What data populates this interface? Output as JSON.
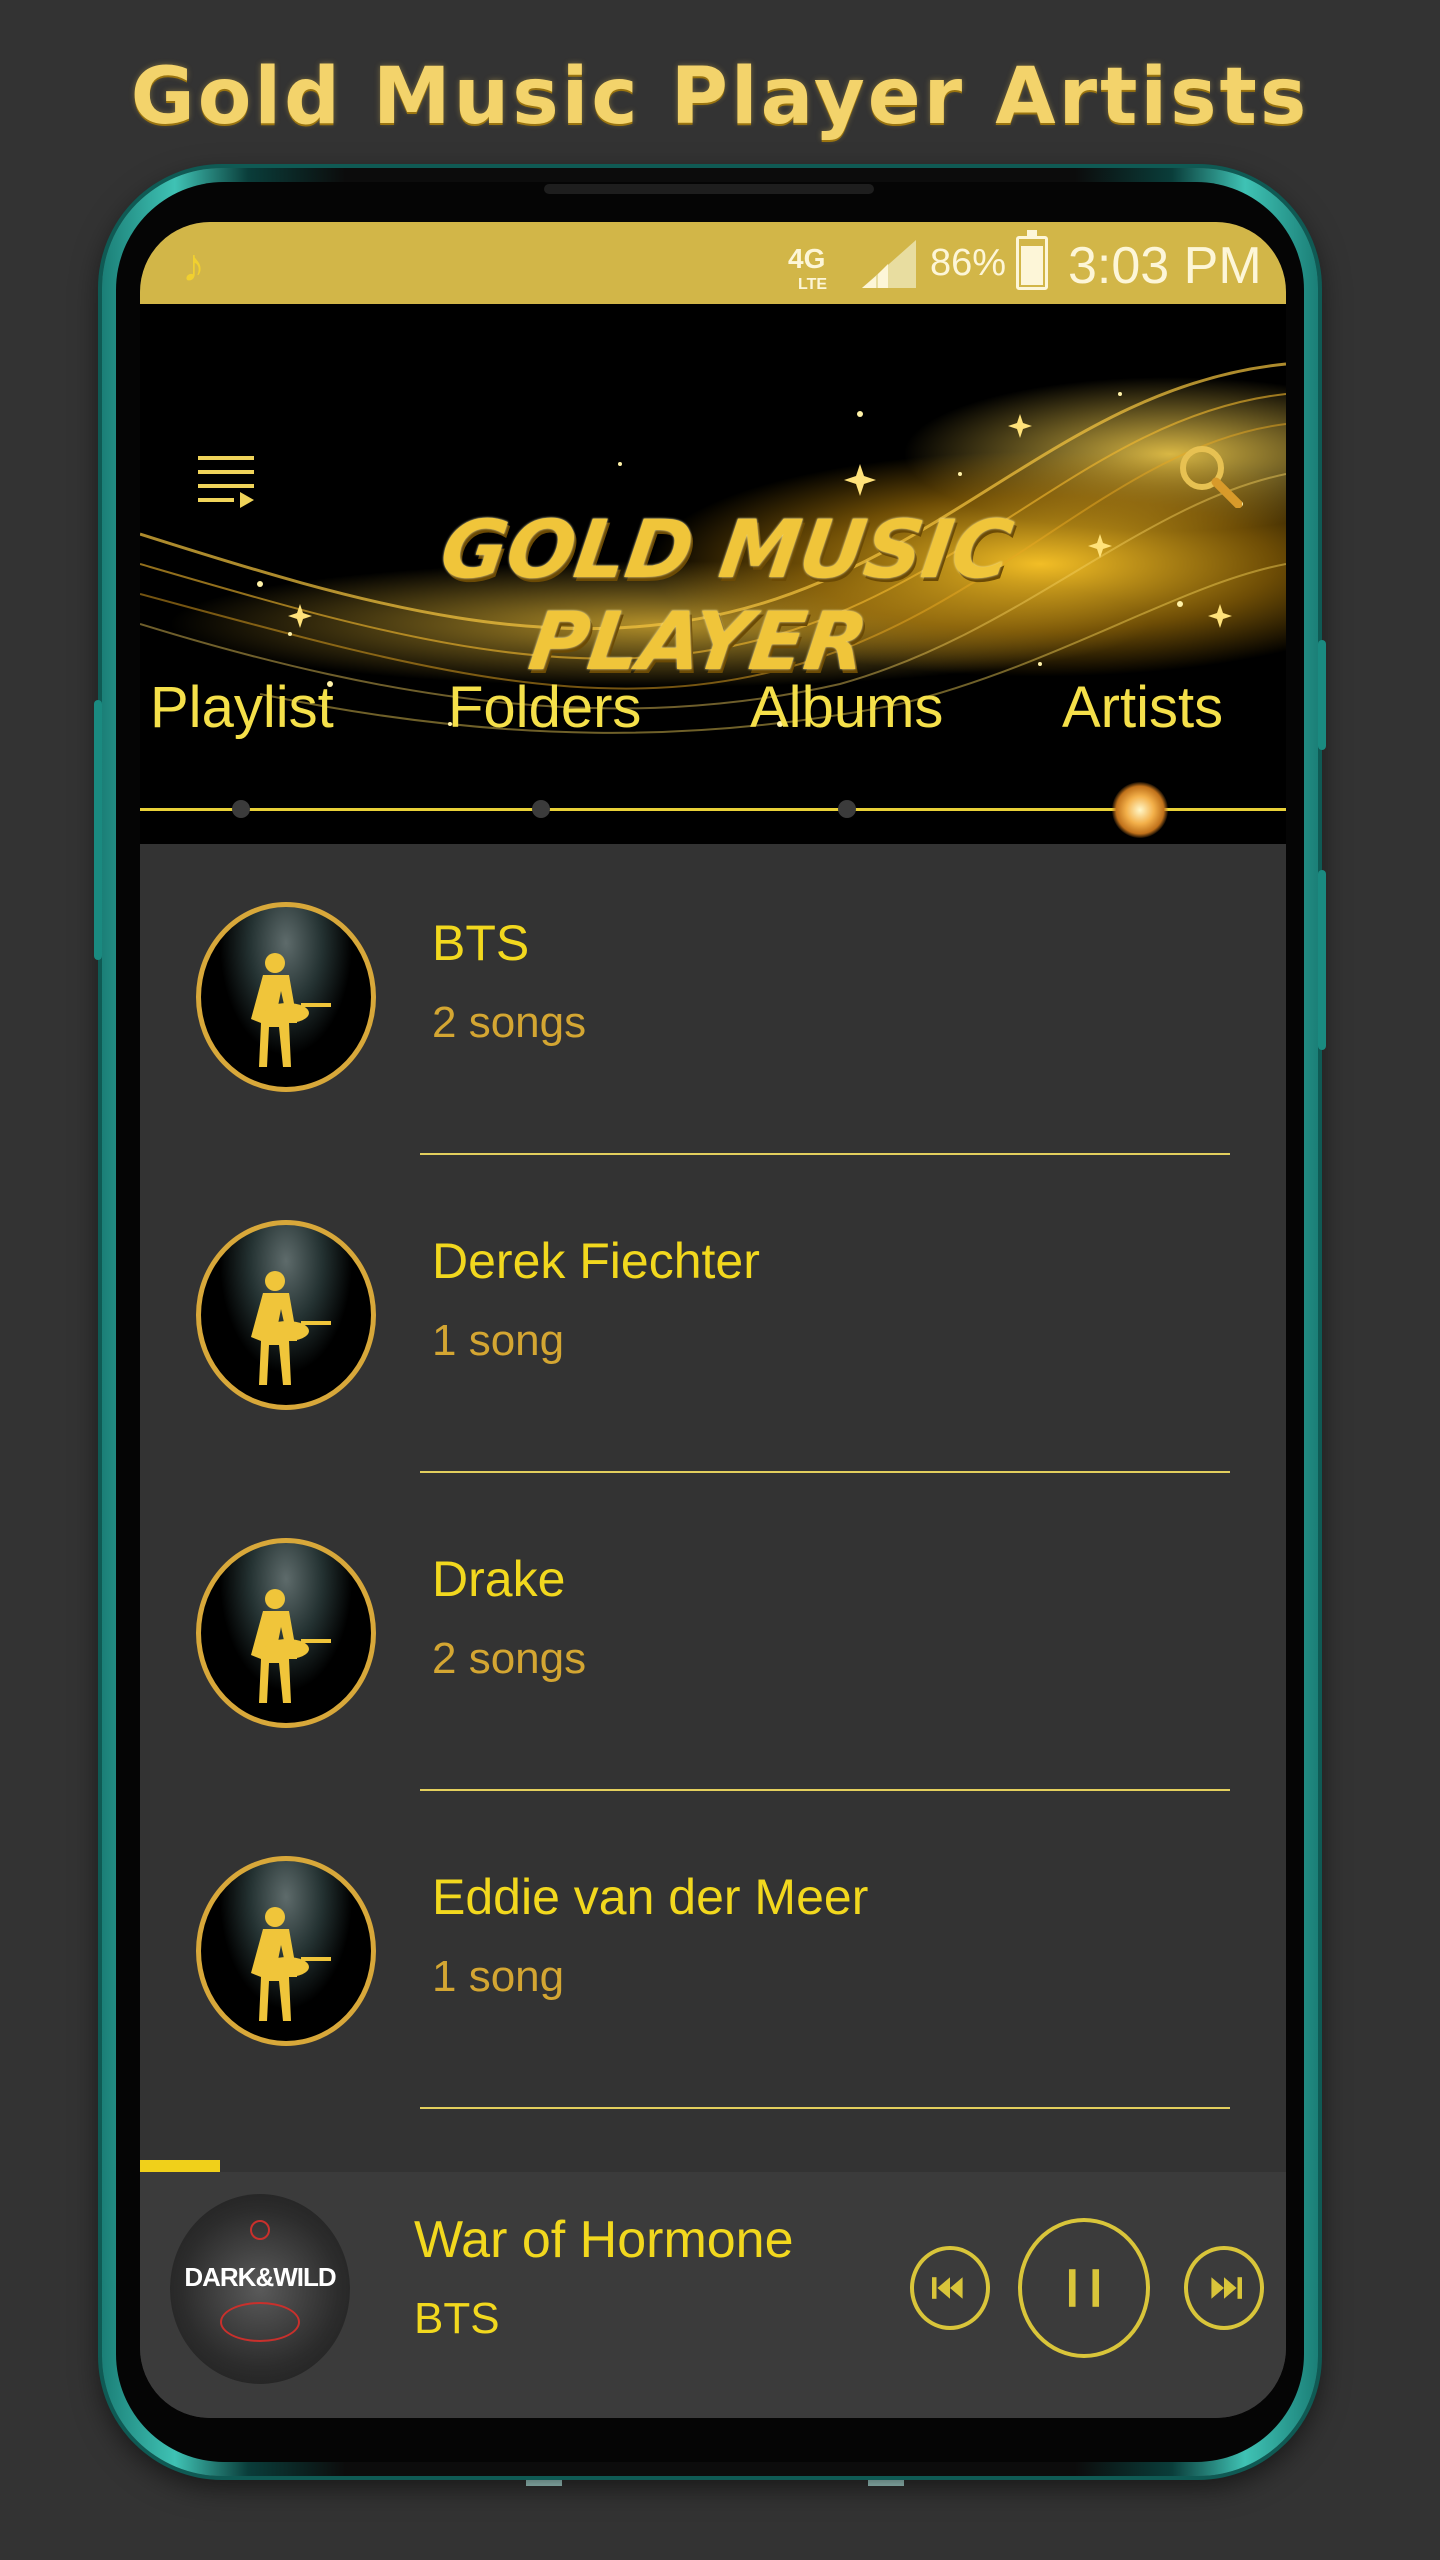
{
  "promo": {
    "title": "Gold Music Player Artists"
  },
  "status_bar": {
    "network_top": "4G",
    "network_bottom": "LTE",
    "battery": "86%",
    "time": "3:03 PM",
    "icon": "music-note-icon"
  },
  "header": {
    "logo_line1": "GOLD MUSIC",
    "logo_line2": "PLAYER",
    "menu_icon": "queue-menu-icon",
    "search_icon": "search-icon"
  },
  "tabs": [
    {
      "label": "Playlist"
    },
    {
      "label": "Folders"
    },
    {
      "label": "Albums"
    },
    {
      "label": "Artists",
      "active": true
    }
  ],
  "artists": [
    {
      "name": "BTS",
      "count": "2 songs"
    },
    {
      "name": "Derek Fiechter",
      "count": "1 song"
    },
    {
      "name": "Drake",
      "count": "2 songs"
    },
    {
      "name": "Eddie van der Meer",
      "count": "1 song"
    }
  ],
  "now_playing": {
    "title": "War of Hormone",
    "artist": "BTS",
    "album_text": "DARK&WILD",
    "controls": [
      "previous-icon",
      "pause-icon",
      "next-icon"
    ]
  },
  "colors": {
    "gold": "#f2d81e",
    "muted_gold": "#d4a632",
    "background": "#333333",
    "status_bar": "#d2b648"
  }
}
